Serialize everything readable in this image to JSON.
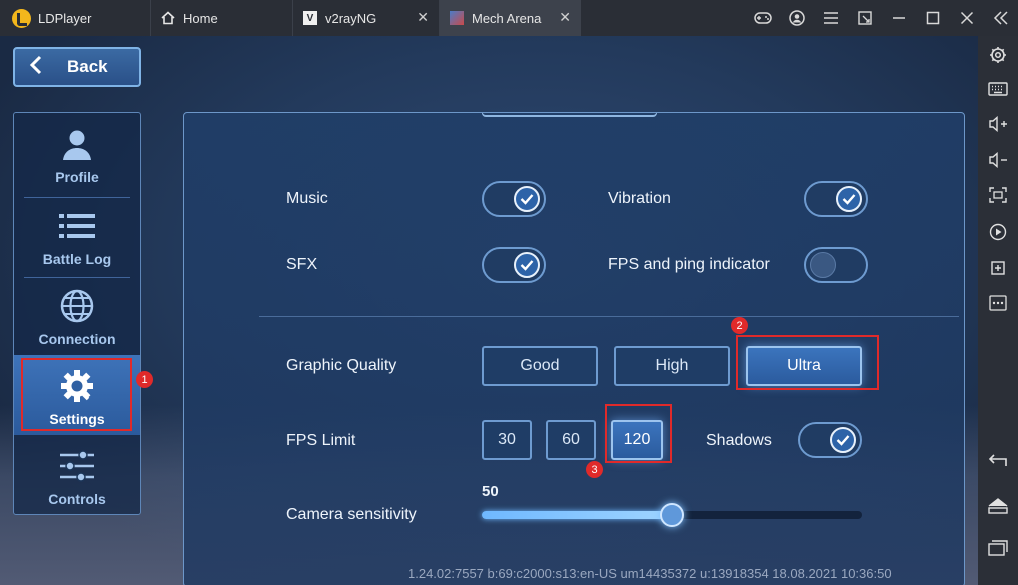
{
  "titlebar": {
    "app_name": "LDPlayer",
    "tabs": [
      {
        "label": "Home",
        "icon": "home-icon"
      },
      {
        "label": "v2rayNG",
        "icon": "v2rayng-icon"
      },
      {
        "label": "Mech Arena",
        "icon": "mech-arena-icon"
      }
    ]
  },
  "game": {
    "back_label": "Back",
    "nav": [
      {
        "label": "Profile",
        "icon": "user-icon"
      },
      {
        "label": "Battle Log",
        "icon": "list-icon"
      },
      {
        "label": "Connection",
        "icon": "globe-icon"
      },
      {
        "label": "Settings",
        "icon": "gear-icon",
        "active": true
      },
      {
        "label": "Controls",
        "icon": "sliders-icon"
      }
    ],
    "settings": {
      "music_label": "Music",
      "music_on": true,
      "vibration_label": "Vibration",
      "vibration_on": true,
      "sfx_label": "SFX",
      "sfx_on": true,
      "fps_ping_label": "FPS and ping indicator",
      "fps_ping_on": false,
      "graphic_quality_label": "Graphic Quality",
      "graphic_options": [
        "Good",
        "High",
        "Ultra"
      ],
      "graphic_selected": "Ultra",
      "fps_limit_label": "FPS Limit",
      "fps_options": [
        "30",
        "60",
        "120"
      ],
      "fps_selected": "120",
      "shadows_label": "Shadows",
      "shadows_on": true,
      "camera_label": "Camera sensitivity",
      "camera_value": "50",
      "camera_fraction": 0.5
    },
    "annotations": [
      "1",
      "2",
      "3"
    ],
    "build_info": "1.24.02:7557 b:69:c2000:s13:en-US um14435372 u:13918354 18.08.2021 10:36:50"
  },
  "colors": {
    "accent": "#3b74bd",
    "annotation": "#e02a2a",
    "titlebar": "#2a2e36"
  }
}
